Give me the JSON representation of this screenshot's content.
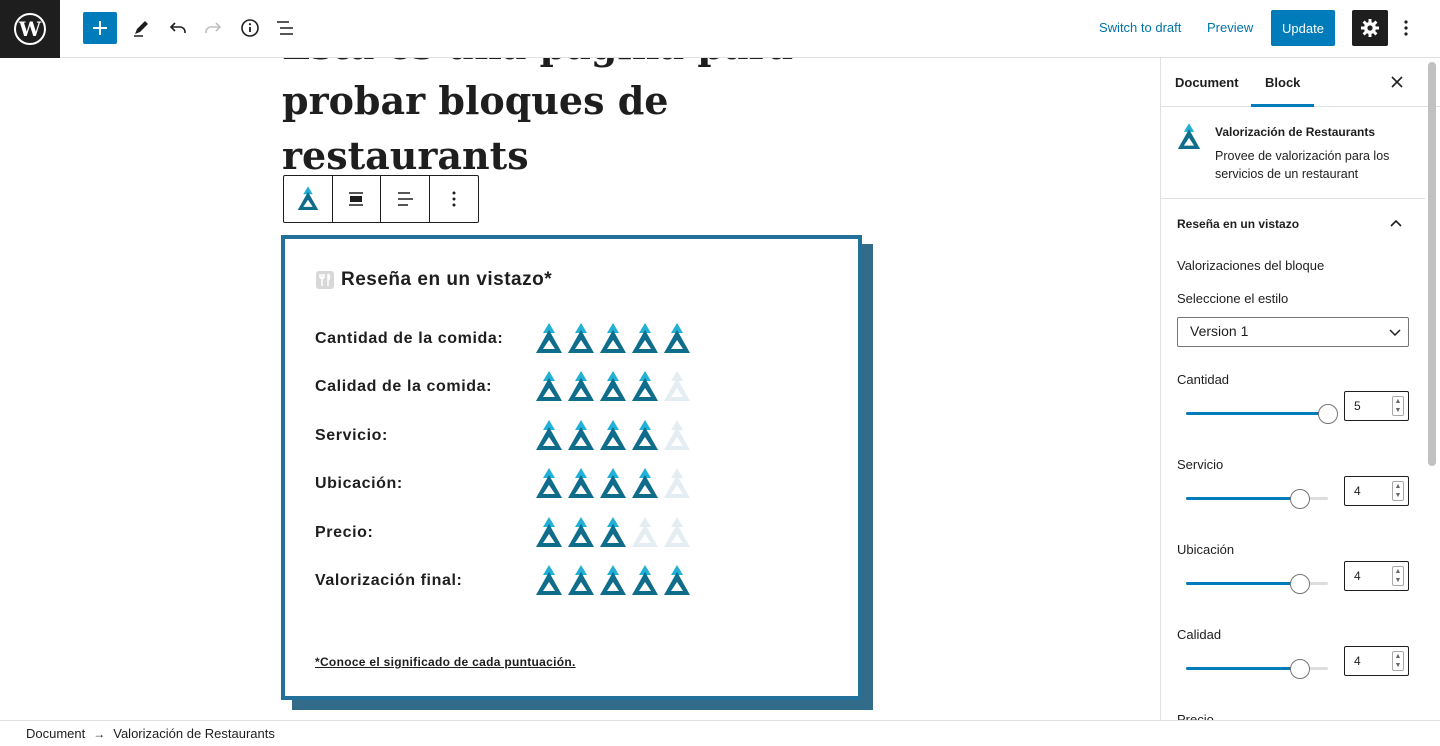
{
  "topbar": {
    "switch_to_draft": "Switch to draft",
    "preview": "Preview",
    "update": "Update"
  },
  "editor": {
    "title_line_1": "Esta es una página para",
    "title_line_2": "probar bloques de",
    "title_line_3": "restaurants"
  },
  "review": {
    "heading": "Reseña en un vistazo*",
    "rows": [
      {
        "label": "Cantidad de la comida:",
        "score": 5
      },
      {
        "label": "Calidad de la comida:",
        "score": 4
      },
      {
        "label": "Servicio:",
        "score": 4
      },
      {
        "label": "Ubicación:",
        "score": 4
      },
      {
        "label": "Precio:",
        "score": 3
      },
      {
        "label": "Valorización final:",
        "score": 5
      }
    ],
    "max_score": 5,
    "link_text": "*Conoce el significado de cada puntuación.",
    "colors": {
      "accent": "#0f6c8b",
      "light": "#22b0d6",
      "muted": "#e4eef2"
    }
  },
  "sidebar": {
    "tabs": [
      "Document",
      "Block"
    ],
    "active_tab": "Block",
    "block_title": "Valorización de Restaurants",
    "block_desc": "Provee de valorización para los servicios de un restaurant",
    "panel_title": "Reseña en un vistazo",
    "ratings_label": "Valorizaciones del bloque",
    "style_label": "Seleccione el estilo",
    "style_value": "Version 1",
    "controls": [
      {
        "label": "Cantidad",
        "value": "5"
      },
      {
        "label": "Servicio",
        "value": "4"
      },
      {
        "label": "Ubicación",
        "value": "4"
      },
      {
        "label": "Calidad",
        "value": "4"
      },
      {
        "label": "Precio",
        "value": ""
      }
    ],
    "control_max": 5
  },
  "footer": {
    "crumbs": [
      "Document",
      "Valorización de Restaurants"
    ]
  }
}
